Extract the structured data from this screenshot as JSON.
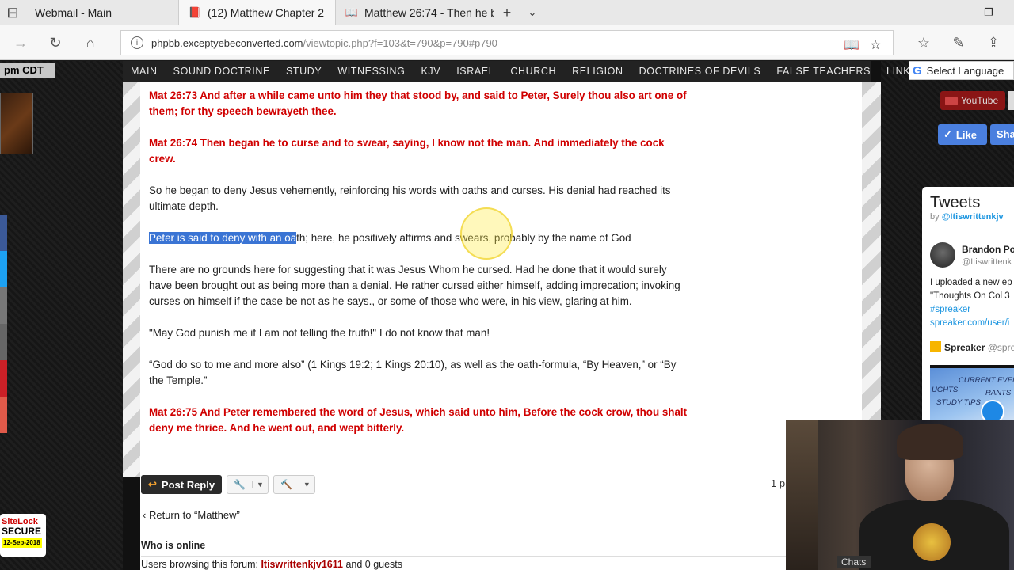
{
  "browser": {
    "tabs": [
      {
        "label": "Webmail - Main",
        "active": false
      },
      {
        "label": "(12) Matthew Chapter 2",
        "active": true
      },
      {
        "label": "Matthew 26:74 - Then he be",
        "active": false
      }
    ],
    "url_host": "phpbb.exceptyebeconverted.com",
    "url_path": "/viewtopic.php?f=103&t=790&p=790#p790"
  },
  "left": {
    "clock": "pm CDT",
    "sitelock": {
      "line1": "SiteLock",
      "line2": "SECURE",
      "date": "12-Sep-2018"
    }
  },
  "menu": [
    "MAIN",
    "SOUND DOCTRINE",
    "STUDY",
    "WITNESSING",
    "KJV",
    "ISRAEL",
    "CHURCH",
    "RELIGION",
    "DOCTRINES OF DEVILS",
    "FALSE TEACHERS",
    "LINKS"
  ],
  "post": {
    "verse73": "Mat 26:73 And after a while came unto him they that stood by, and said to Peter, Surely thou also art one of them; for thy speech bewrayeth thee.",
    "verse74": "Mat 26:74 Then began he to curse and to swear, saying, I know not the man. And immediately the cock crew.",
    "para1": "So he began to deny Jesus vehemently, reinforcing his words with oaths and curses. His denial had reached its ultimate depth.",
    "para2_selected": "Peter is said to deny with an oa",
    "para2_rest": "th; here, he positively affirms and swears, probably by the name of God",
    "para3": "There are no grounds here for suggesting that it was Jesus Whom he cursed. Had he done that it would surely have been brought out as being more than a denial. He rather cursed either himself, adding imprecation; invoking curses on himself if the case be not as he says., or some of those who were, in his view, glaring at him.",
    "para4": "\"May God punish me if I am not telling the truth!\" I do not know that man!",
    "para5": "“God do so to me and more also” (1 Kings 19:2; 1 Kings 20:10), as well as the oath-formula, “By Heaven,” or “By the Temple.”",
    "verse75": "Mat 26:75 And Peter remembered the word of Jesus, which said unto him, Before the cock crow, thou shalt deny me thrice. And he went out, and wept bitterly."
  },
  "actions": {
    "post_reply": "Post Reply",
    "pager": "1 p",
    "return_link": "Return to “Matthew”",
    "who_online": "Who is online",
    "online_prefix": "Users browsing this forum: ",
    "online_user": "Itiswrittenkjv1611",
    "online_suffix": " and 0 guests"
  },
  "right": {
    "language": "Select Language",
    "youtube": "YouTube",
    "like": "Like",
    "share": "Sha",
    "tweets_title": "Tweets",
    "tweets_by": "by ",
    "tweets_handle": "@Itiswrittenkjv",
    "tweet_name": "Brandon Po",
    "tweet_user": "@Itiswrittenk",
    "tweet_line1": "I uploaded a new ep",
    "tweet_line2": "\"Thoughts On Col 3",
    "tweet_tag": "#spreaker",
    "tweet_link": "spreaker.com/user/i",
    "spreaker_name": "Spreaker",
    "spreaker_handle": "@spre",
    "img_text1": "CURRENT EVENTS",
    "img_text2": "UGHTS",
    "img_text3": "RANTS",
    "img_text4": "STUDY TIPS"
  },
  "webcam": {
    "chats": "Chats"
  }
}
